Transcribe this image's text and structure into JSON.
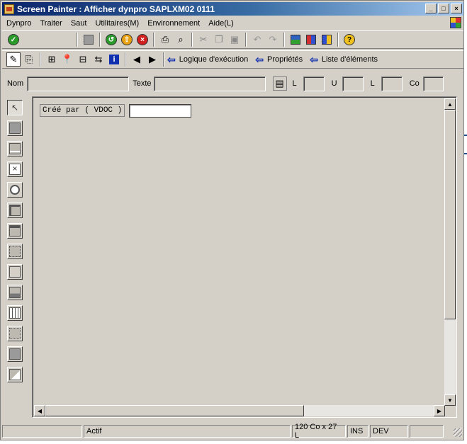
{
  "window": {
    "title": "Screen Painter : Afficher dynpro SAPLXM02 0111",
    "controls": {
      "minimize": "_",
      "maximize": "□",
      "close": "×"
    }
  },
  "menubar": {
    "items": [
      "Dynpro",
      "Traiter",
      "Saut",
      "Utilitaires(M)",
      "Environnement",
      "Aide(L)"
    ]
  },
  "toolbar1": {
    "icons": [
      "check-icon",
      "save-icon",
      "back-icon",
      "exit-icon",
      "cancel-icon",
      "print-icon",
      "find-icon",
      "cut-icon",
      "copy-icon",
      "paste-icon",
      "undo-icon",
      "redo-icon",
      "layout-icon",
      "color-icon",
      "window-icon",
      "help-icon"
    ]
  },
  "toolbar2": {
    "nav": [
      {
        "label": "Logique d'exécution"
      },
      {
        "label": "Propriétés"
      },
      {
        "label": "Liste d'éléments"
      }
    ]
  },
  "attributes": {
    "name_label": "Nom",
    "name_value": "",
    "text_label": "Texte",
    "text_value": "",
    "l1_label": "L",
    "l1_value": "",
    "u_label": "U",
    "u_value": "",
    "l2_label": "L",
    "l2_value": "",
    "co_label": "Co",
    "co_value": ""
  },
  "palette": {
    "items": [
      "pointer",
      "text-field",
      "input-output-field",
      "checkbox",
      "radio-button",
      "frame",
      "tabstrip",
      "subscreen",
      "custom-control",
      "table-control",
      "step-loop",
      "status-icon",
      "push-button",
      "graphic-element"
    ]
  },
  "canvas": {
    "label_text": "Créé par ( VDOC )",
    "input_value": ""
  },
  "statusbar": {
    "empty": "",
    "mode": "Actif",
    "size": "120 Co x 27 L",
    "ins": "INS",
    "system": "DEV",
    "extra": ""
  }
}
